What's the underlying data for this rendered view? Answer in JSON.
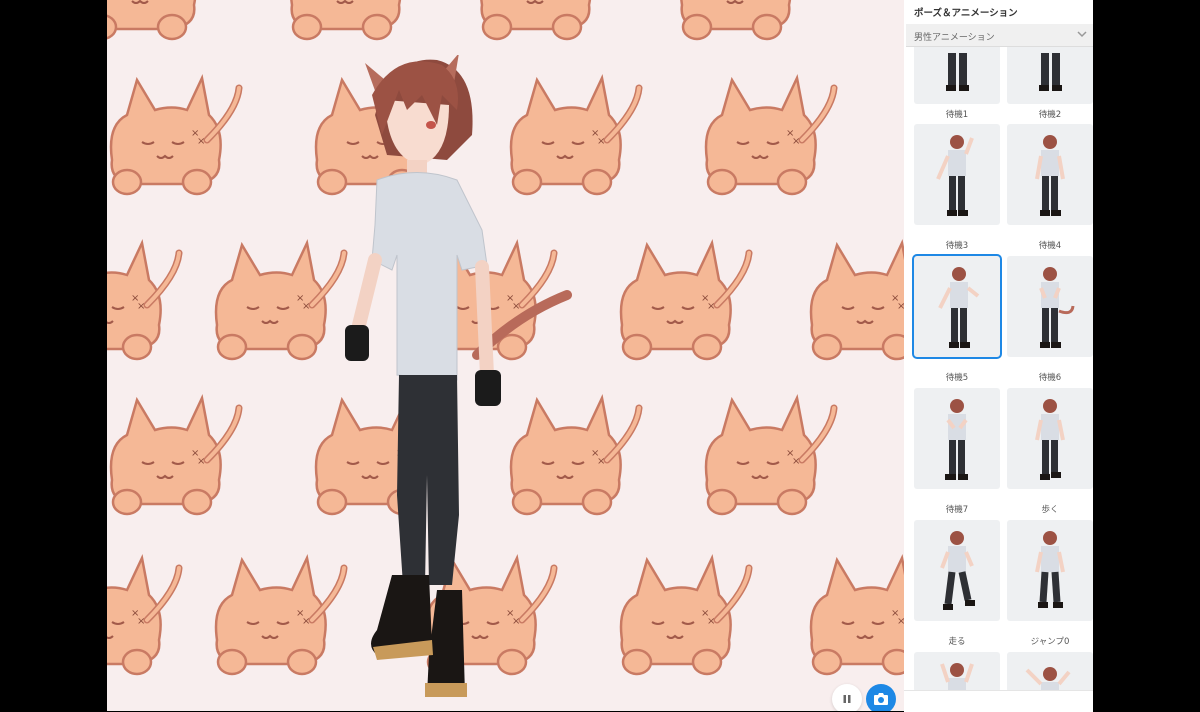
{
  "panel": {
    "title": "ポーズ＆アニメーション",
    "category": "男性アニメーション",
    "items": [
      {
        "label": "待機1",
        "selected": false
      },
      {
        "label": "待機2",
        "selected": false
      },
      {
        "label": "待機3",
        "selected": false
      },
      {
        "label": "待機4",
        "selected": false
      },
      {
        "label": "待機5",
        "selected": true
      },
      {
        "label": "待機6",
        "selected": false
      },
      {
        "label": "待機7",
        "selected": false
      },
      {
        "label": "歩く",
        "selected": false
      },
      {
        "label": "走る",
        "selected": false
      },
      {
        "label": "ジャンプ0",
        "selected": false
      },
      {
        "label": "",
        "selected": false
      },
      {
        "label": "",
        "selected": false
      }
    ]
  },
  "controls": {
    "pause_icon": "pause-icon",
    "camera_icon": "camera-icon"
  },
  "colors": {
    "accent": "#1e88e5",
    "background": "#f8eeee",
    "cat_pattern": "#f2b08a"
  }
}
